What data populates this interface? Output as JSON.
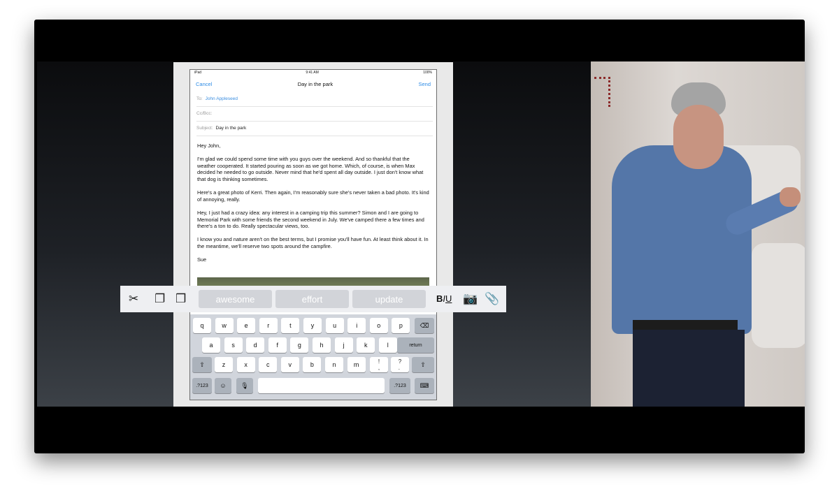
{
  "ipad_status": {
    "left": "iPad",
    "time": "9:41 AM",
    "battery": "100%"
  },
  "mail": {
    "cancel": "Cancel",
    "title": "Day in the park",
    "send": "Send",
    "to_label": "To:",
    "to_value": "John Appleseed",
    "cc_label": "Cc/Bcc:",
    "subject_label": "Subject:",
    "subject_value": "Day in the park",
    "body": [
      "Hey John,",
      "I'm glad we could spend some time with you guys over the weekend. And so thankful that the weather cooperated. It started pouring as soon as we got home. Which, of course, is when Max decided he needed to go outside. Never mind that he'd spent all day outside. I just don't know what that dog is thinking sometimes.",
      "Here's a great photo of Kerri. Then again, I'm reasonably sure she's never taken a bad photo. It's kind of annoying, really.",
      "Hey, I just had a crazy idea: any interest in a camping trip this summer? Simon and I are going to Memorial Park with some friends the second weekend in July. We've camped there a few times and there's a ton to do. Really spectacular views, too.",
      "I know you and nature aren't on the best terms, but I promise you'll have fun. At least think about it. In the meantime, we'll reserve two spots around the campfire.",
      "Sue"
    ]
  },
  "shortcut_bar": {
    "icons": [
      "cut-icon",
      "copy-icon",
      "paste-icon",
      "camera-icon",
      "paperclip-icon"
    ],
    "suggestions": [
      "awesome",
      "effort",
      "update"
    ],
    "biu": "B I U"
  },
  "keyboard": {
    "row1": [
      "q",
      "w",
      "e",
      "r",
      "t",
      "y",
      "u",
      "i",
      "o",
      "p"
    ],
    "row2": [
      "a",
      "s",
      "d",
      "f",
      "g",
      "h",
      "j",
      "k",
      "l"
    ],
    "return": "return",
    "row3": [
      "z",
      "x",
      "c",
      "v",
      "b",
      "n",
      "m"
    ],
    "punct1": "!\n,",
    "punct2": "?\n.",
    "numbers": ".?123"
  }
}
